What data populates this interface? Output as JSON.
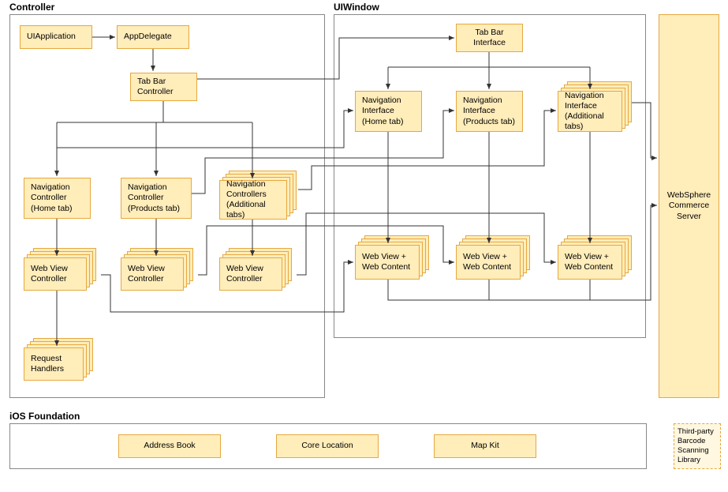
{
  "diagram": {
    "containers": {
      "controller": "Controller",
      "uiwindow": "UIWindow",
      "ios_foundation": "iOS Foundation"
    },
    "nodes": {
      "uiapplication": "UIApplication",
      "appdelegate": "AppDelegate",
      "tabbar_controller": "Tab Bar Controller",
      "nav_ctrl_home": "Navigation Controller (Home tab)",
      "nav_ctrl_products": "Navigation Controller (Products tab)",
      "nav_ctrl_additional": "Navigation Controllers (Additional tabs)",
      "webview_ctrl_1": "Web View Controller",
      "webview_ctrl_2": "Web View Controller",
      "webview_ctrl_3": "Web View Controller",
      "request_handlers": "Request Handlers",
      "tabbar_interface": "Tab Bar Interface",
      "nav_iface_home": "Navigation Interface (Home tab)",
      "nav_iface_products": "Navigation Interface (Products tab)",
      "nav_iface_additional": "Navigation Interface (Additional tabs)",
      "webview_content_1": "Web View + Web Content",
      "webview_content_2": "Web View + Web Content",
      "webview_content_3": "Web View + Web Content",
      "address_book": "Address Book",
      "core_location": "Core Location",
      "map_kit": "Map Kit",
      "websphere": "WebSphere Commerce Server",
      "third_party": "Third-party Barcode Scanning Library"
    }
  }
}
